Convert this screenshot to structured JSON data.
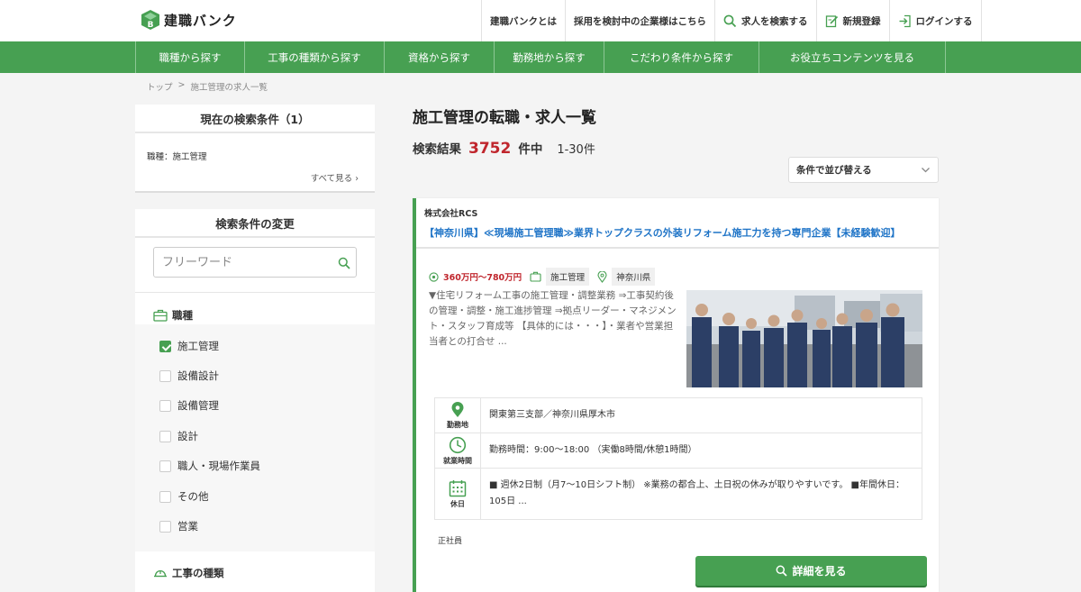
{
  "header": {
    "logo_text": "建職バンク",
    "nav": [
      {
        "label": "建職バンクとは",
        "icon": ""
      },
      {
        "label": "採用を検討中の企業様はこちら",
        "icon": ""
      },
      {
        "label": "求人を検索する",
        "icon": "search-icon"
      },
      {
        "label": "新規登録",
        "icon": "edit-icon"
      },
      {
        "label": "ログインする",
        "icon": "login-icon"
      }
    ]
  },
  "green_nav": [
    "職種から探す",
    "工事の種類から探す",
    "資格から探す",
    "勤務地から探す",
    "こだわり条件から探す",
    "お役立ちコンテンツを見る"
  ],
  "breadcrumb": {
    "home": "トップ",
    "sep": ">",
    "current": "施工管理の求人一覧"
  },
  "sidebar": {
    "current_title": "現在の検索条件（1）",
    "current_condition": "職種：施工管理",
    "see_all": "すべて見る",
    "change_title": "検索条件の変更",
    "freeword_placeholder": "フリーワード",
    "job_type_title": "職種",
    "job_types": [
      {
        "label": "施工管理",
        "checked": true
      },
      {
        "label": "設備設計",
        "checked": false
      },
      {
        "label": "設備管理",
        "checked": false
      },
      {
        "label": "設計",
        "checked": false
      },
      {
        "label": "職人・現場作業員",
        "checked": false
      },
      {
        "label": "その他",
        "checked": false
      },
      {
        "label": "営業",
        "checked": false
      }
    ],
    "construction_title": "工事の種類"
  },
  "main": {
    "title": "施工管理の転職・求人一覧",
    "result_label": "検索結果",
    "count": "3752",
    "unit": "件中",
    "range": "1-30件",
    "sort_label": "条件で並び替える"
  },
  "job": {
    "company": "株式会社RCS",
    "title": "【神奈川県】≪現場施工管理職≫業界トップクラスの外装リフォーム施工力を持つ専門企業【未経験歓迎】",
    "salary": "360万円〜780万円",
    "type_tag": "施工管理",
    "location_tag": "神奈川県",
    "description": "▼住宅リフォーム工事の施工管理・調整業務 ⇒工事契約後の管理・調整・施工進捗管理 ⇒拠点リーダー・マネジメント・スタッフ育成等 【具体的には・・・】・業者や営業担当者との打合せ ...",
    "info": [
      {
        "label": "勤務地",
        "icon": "map-pin-icon",
        "value": "関東第三支部／神奈川県厚木市"
      },
      {
        "label": "就業時間",
        "icon": "clock-icon",
        "value": "勤務時間：9:00〜18:00 （実働8時間/休憩1時間）"
      },
      {
        "label": "休日",
        "icon": "calendar-icon",
        "value": "■ 週休2日制（月7〜10日シフト制） ※業務の都合上、土日祝の休みが取りやすいです。 ■年間休日：105日 ..."
      }
    ],
    "employment": "正社員",
    "detail_button": "詳細を見る"
  },
  "colors": {
    "brand_green": "#47a052",
    "accent_red": "#c0262d",
    "link_blue": "#1f74c7"
  }
}
